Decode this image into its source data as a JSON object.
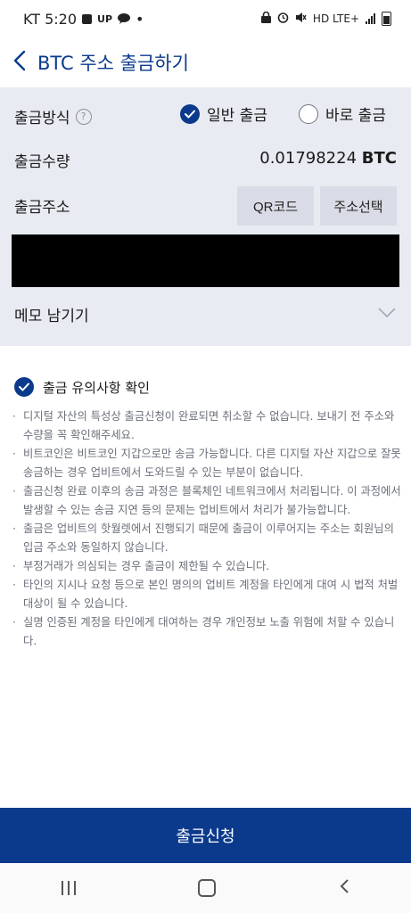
{
  "status_bar": {
    "carrier_time": "KT 5:20",
    "icons_left": [
      "gallery-icon",
      "up-icon",
      "talk-icon"
    ],
    "up_label": "UP",
    "dot": "•",
    "network": "HD LTE+",
    "icons_right": [
      "lock-icon",
      "alarm-icon",
      "mute-icon",
      "signal-icon",
      "battery-icon"
    ]
  },
  "header": {
    "back_icon": "‹",
    "title": "BTC 주소 출금하기"
  },
  "form": {
    "method_label": "출금방식",
    "help_icon": "?",
    "options": [
      {
        "label": "일반 출금",
        "selected": true
      },
      {
        "label": "바로 출금",
        "selected": false
      }
    ],
    "amount_label": "출금수량",
    "amount_value": "0.01798224",
    "amount_unit": "BTC",
    "address_label": "출금주소",
    "qr_button": "QR코드",
    "select_button": "주소선택",
    "memo_label": "메모 남기기"
  },
  "notice": {
    "confirm_label": "출금 유의사항 확인",
    "checked": true,
    "items": [
      "디지털 자산의 특성상 출금신청이 완료되면 취소할 수 없습니다. 보내기 전 주소와 수량을 꼭 확인해주세요.",
      "비트코인은 비트코인 지갑으로만 송금 가능합니다. 다른 디지털 자산 지갑으로 잘못 송금하는 경우 업비트에서 도와드릴 수 있는 부분이 없습니다.",
      "출금신청 완료 이후의 송금 과정은 블록체인 네트워크에서 처리됩니다. 이 과정에서 발생할 수 있는 송금 지연 등의 문제는 업비트에서 처리가 불가능합니다.",
      "출금은 업비트의 핫월렛에서 진행되기 때문에 출금이 이루어지는 주소는 회원님의 입금 주소와 동일하지 않습니다.",
      "부정거래가 의심되는 경우 출금이 제한될 수 있습니다.",
      "타인의 지시나 요청 등으로 본인 명의의 업비트 계정을 타인에게 대여 시 법적 처벌 대상이 될 수 있습니다.",
      "실명 인증된 계정을 타인에게 대여하는 경우 개인정보 노출 위험에 처할 수 있습니다."
    ]
  },
  "submit_button": "출금신청",
  "colors": {
    "accent": "#0b3a8c",
    "form_bg": "#e9ebf2",
    "button_gray": "#d9dce6",
    "note_text": "#6b6f7a"
  }
}
